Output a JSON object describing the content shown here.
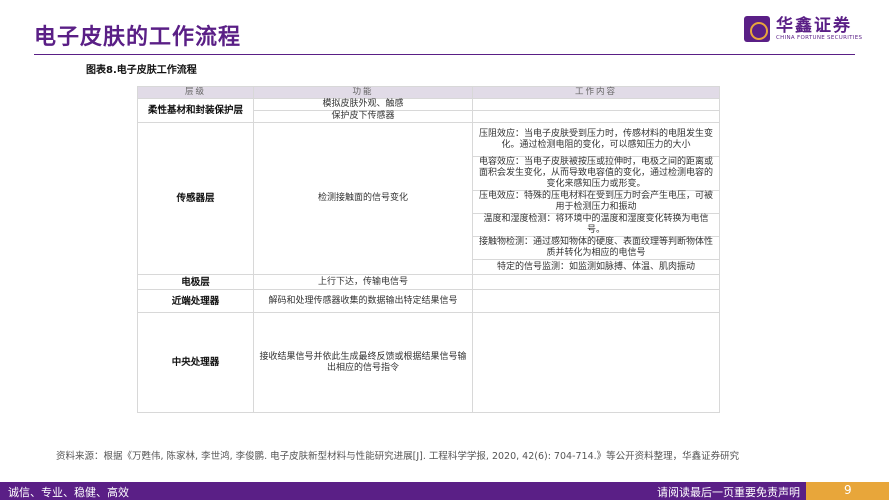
{
  "header": {
    "title": "电子皮肤的工作流程",
    "logo_cn": "华鑫证券",
    "logo_en": "CHINA FORTUNE SECURITIES"
  },
  "figure_caption": "图表8.电子皮肤工作流程",
  "table": {
    "headers": [
      "层级",
      "功能",
      "工作内容"
    ],
    "layer1": {
      "name": "柔性基材和封装保护层",
      "func1": "模拟皮肤外观、触感",
      "func2": "保护皮下传感器"
    },
    "layer2": {
      "name": "传感器层",
      "func": "检测接触面的信号变化",
      "contents": [
        "压阻效应：当电子皮肤受到压力时，传感材料的电阻发生变化。通过检测电阻的变化，可以感知压力的大小",
        "电容效应：当电子皮肤被按压或拉伸时，电极之间的距离或面积会发生变化，从而导致电容值的变化，通过检测电容的变化来感知压力或形变。",
        "压电效应：特殊的压电材料在受到压力时会产生电压，可被用于检测压力和振动",
        "温度和湿度检测：将环境中的温度和湿度变化转换为电信号。",
        "接触物检测：通过感知物体的硬度、表面纹理等判断物体性质并转化为相应的电信号",
        "特定的信号监测：如监测如脉搏、体温、肌肉振动"
      ]
    },
    "layer3": {
      "name": "电极层",
      "func": "上行下达，传输电信号"
    },
    "layer4": {
      "name": "近端处理器",
      "func": "解码和处理传感器收集的数据输出特定结果信号"
    },
    "layer5": {
      "name": "中央处理器",
      "func": "接收结果信号并依此生成最终反馈或根据结果信号输出相应的信号指令"
    }
  },
  "source": "资料来源：根据《万甦伟, 陈家林, 李世鸿, 李俊鹏. 电子皮肤新型材料与性能研究进展[J]. 工程科学学报, 2020, 42(6): 704-714.》等公开资料整理，华鑫证券研究",
  "footer": {
    "left": "诚信、专业、稳健、高效",
    "right": "请阅读最后一页重要免责声明",
    "page_number": "9"
  },
  "colors": {
    "brand": "#5a1f86",
    "accent": "#e8a63a",
    "header_fill": "#e1dbe7"
  }
}
